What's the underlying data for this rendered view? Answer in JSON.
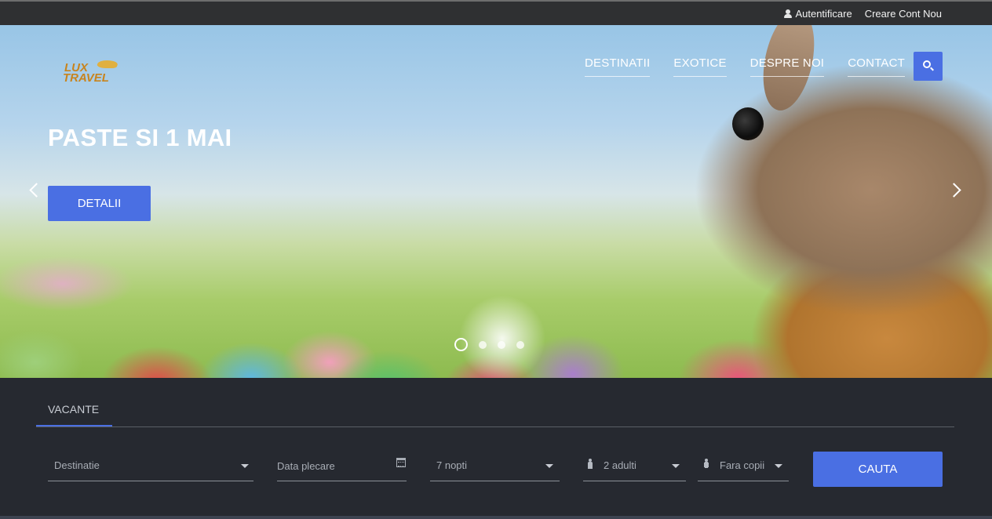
{
  "topbar": {
    "login_label": "Autentificare",
    "register_label": "Creare Cont Nou"
  },
  "logo": {
    "line1": "LUX",
    "line2": "TRAVEL"
  },
  "nav": {
    "items": [
      "DESTINATII",
      "EXOTICE",
      "DESPRE NOI",
      "CONTACT"
    ]
  },
  "hero": {
    "title": "PASTE SI 1 MAI",
    "button_label": "DETALII",
    "slides_total": 4,
    "active_slide": 1
  },
  "search": {
    "tab_label": "VACANTE",
    "destination_placeholder": "Destinatie",
    "date_placeholder": "Data plecare",
    "nights_value": "7 nopti",
    "adults_value": "2 adulti",
    "children_value": "Fara copii",
    "submit_label": "CAUTA"
  },
  "colors": {
    "accent": "#4a6fe3",
    "topbar_bg": "#2f3032",
    "panel_bg": "#262930",
    "logo": "#c8841e"
  },
  "icons": [
    "user-icon",
    "search-icon",
    "chevron-left-icon",
    "chevron-right-icon",
    "calendar-icon",
    "person-icon",
    "child-icon",
    "caret-down-icon"
  ]
}
